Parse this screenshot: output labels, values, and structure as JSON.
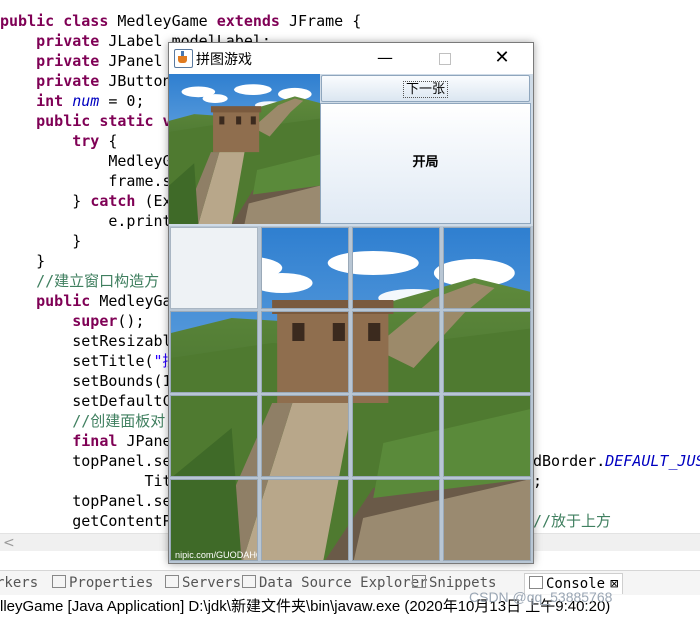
{
  "editor": {
    "lines": [
      {
        "parts": [
          [
            "kw",
            "public class "
          ],
          [
            "t",
            "MedleyGame "
          ],
          [
            "kw",
            "extends "
          ],
          [
            "t",
            "JFrame {"
          ]
        ]
      },
      {
        "parts": [
          [
            "t",
            "    "
          ],
          [
            "kw",
            "private "
          ],
          [
            "t",
            "JLabel "
          ],
          [
            "sq",
            "modelLabel"
          ],
          [
            "t",
            ";"
          ]
        ]
      },
      {
        "parts": [
          [
            "t",
            "    "
          ],
          [
            "kw",
            "private "
          ],
          [
            "t",
            "JPanel"
          ]
        ]
      },
      {
        "parts": [
          [
            "t",
            "    "
          ],
          [
            "kw",
            "private "
          ],
          [
            "t",
            "JButton"
          ]
        ]
      },
      {
        "parts": [
          [
            "t",
            "    "
          ],
          [
            "kw",
            "int "
          ],
          [
            "it",
            "num"
          ],
          [
            "t",
            " = 0;"
          ]
        ]
      },
      {
        "parts": [
          [
            "t",
            "    "
          ],
          [
            "kw",
            "public static v"
          ]
        ]
      },
      {
        "parts": [
          [
            "t",
            "        "
          ],
          [
            "kw",
            "try "
          ],
          [
            "t",
            "{"
          ]
        ]
      },
      {
        "parts": [
          [
            "t",
            "            MedleyG"
          ]
        ]
      },
      {
        "parts": [
          [
            "t",
            "            frame.s"
          ]
        ]
      },
      {
        "parts": [
          [
            "t",
            "        } "
          ],
          [
            "kw",
            "catch "
          ],
          [
            "t",
            "(Ex"
          ]
        ]
      },
      {
        "parts": [
          [
            "t",
            "            e.print"
          ]
        ]
      },
      {
        "parts": [
          [
            "t",
            "        }"
          ]
        ]
      },
      {
        "parts": [
          [
            "t",
            "    }"
          ]
        ]
      },
      {
        "parts": [
          [
            "cm",
            "    //建立窗口构造方"
          ]
        ]
      },
      {
        "parts": [
          [
            "t",
            "    "
          ],
          [
            "kw",
            "public "
          ],
          [
            "t",
            "MedleyGa"
          ]
        ]
      },
      {
        "parts": [
          [
            "t",
            "        "
          ],
          [
            "kw",
            "super"
          ],
          [
            "t",
            "();"
          ]
        ]
      },
      {
        "parts": [
          [
            "t",
            "        setResizabl"
          ]
        ]
      },
      {
        "parts": [
          [
            "t",
            "        setTitle("
          ],
          [
            "st",
            "\"拼"
          ]
        ]
      },
      {
        "parts": [
          [
            "t",
            "        setBounds(1"
          ]
        ]
      },
      {
        "parts": [
          [
            "t",
            "        setDefaultC"
          ]
        ]
      },
      {
        "parts": [
          [
            "cm",
            "        //创建面板对"
          ]
        ]
      },
      {
        "parts": [
          [
            "t",
            "        "
          ],
          [
            "kw",
            "final "
          ],
          [
            "t",
            "JPane"
          ]
        ]
      },
      {
        "parts": [
          [
            "t",
            "        topPanel.se"
          ]
        ]
      },
      {
        "parts": [
          [
            "t",
            "                Tit"
          ]
        ]
      },
      {
        "parts": [
          [
            "t",
            "        topPanel.se"
          ]
        ]
      },
      {
        "parts": [
          [
            "t",
            "        getContentP"
          ]
        ]
      }
    ],
    "right_fragments": [
      {
        "line": 22,
        "parts": [
          [
            "t",
            "dBorder."
          ],
          [
            "it",
            "DEFAULT_JUS"
          ]
        ]
      },
      {
        "line": 23,
        "parts": [
          [
            "t",
            ";"
          ]
        ]
      },
      {
        "line": 25,
        "parts": [
          [
            "cm",
            "//放于上方"
          ]
        ]
      }
    ]
  },
  "bottom_tabs": {
    "items": [
      {
        "label": "rkers",
        "active": false
      },
      {
        "label": "Properties",
        "active": false
      },
      {
        "label": "Servers",
        "active": false
      },
      {
        "label": "Data Source Explorer",
        "active": false
      },
      {
        "label": "Snippets",
        "active": false
      },
      {
        "label": "Console",
        "active": true
      }
    ],
    "close_glyph": "⊠"
  },
  "console": {
    "launch_line": "lleyGame [Java Application] D:\\jdk\\新建文件夹\\bin\\javaw.exe (2020年10月13日 上午9:40:20)"
  },
  "watermark": "CSDN @qq_53885768",
  "window": {
    "title": "拼图游戏",
    "min_glyph": "—",
    "close_glyph": "✕",
    "next_button_label": "下一张",
    "start_button_label": "开局",
    "preview_image": "great-wall-thumbnail",
    "board": {
      "rows": 4,
      "cols": 4,
      "blank_cell": [
        0,
        0
      ],
      "image_credit": "nipic.com/GUODAHONG"
    }
  },
  "colors": {
    "keyword": "#7f0055",
    "comment": "#3f7f5f",
    "string": "#2a00ff",
    "field": "#0000c0",
    "button_gradient_top": "#fafcfe",
    "button_gradient_bottom": "#dbe6f1"
  }
}
